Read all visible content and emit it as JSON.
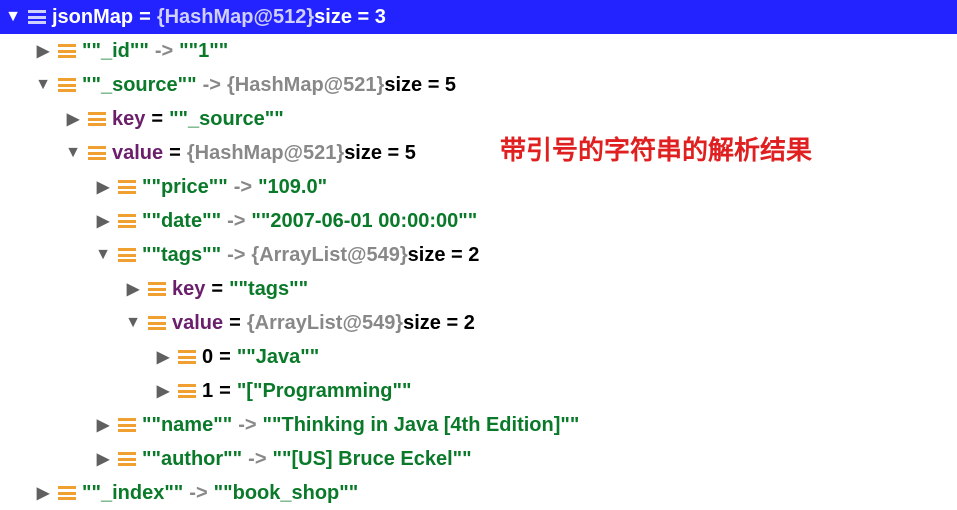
{
  "header": {
    "var": "jsonMap",
    "eq": " = ",
    "obj": "{HashMap@512}",
    "size": "  size = 3"
  },
  "annotation": "带引号的字符串的解析结果",
  "r1": {
    "key": "\"\"_id\"\"",
    "arrow": " -> ",
    "val": "\"\"1\"\""
  },
  "r2": {
    "key": "\"\"_source\"\"",
    "arrow": " -> ",
    "obj": "{HashMap@521}",
    "size": "  size = 5"
  },
  "r3": {
    "field": "key",
    "eq": " = ",
    "val": "\"\"_source\"\""
  },
  "r4": {
    "field": "value",
    "eq": " = ",
    "obj": "{HashMap@521}",
    "size": "  size = 5"
  },
  "r5": {
    "key": "\"\"price\"\"",
    "arrow": " -> ",
    "val": "\"109.0\""
  },
  "r6": {
    "key": "\"\"date\"\"",
    "arrow": " -> ",
    "val": "\"\"2007-06-01 00:00:00\"\""
  },
  "r7": {
    "key": "\"\"tags\"\"",
    "arrow": " -> ",
    "obj": "{ArrayList@549}",
    "size": "  size = 2"
  },
  "r8": {
    "field": "key",
    "eq": " = ",
    "val": "\"\"tags\"\""
  },
  "r9": {
    "field": "value",
    "eq": " = ",
    "obj": "{ArrayList@549}",
    "size": "  size = 2"
  },
  "r10": {
    "idx": "0",
    "eq": " = ",
    "val": "\"\"Java\"\""
  },
  "r11": {
    "idx": "1",
    "eq": " = ",
    "val": "\"[\"Programming\"\""
  },
  "r12": {
    "key": "\"\"name\"\"",
    "arrow": " -> ",
    "val": "\"\"Thinking in Java [4th Edition]\"\""
  },
  "r13": {
    "key": "\"\"author\"\"",
    "arrow": " -> ",
    "val": "\"\"[US] Bruce Eckel\"\""
  },
  "r14": {
    "key": "\"\"_index\"\"",
    "arrow": " -> ",
    "val": "\"\"book_shop\"\""
  }
}
